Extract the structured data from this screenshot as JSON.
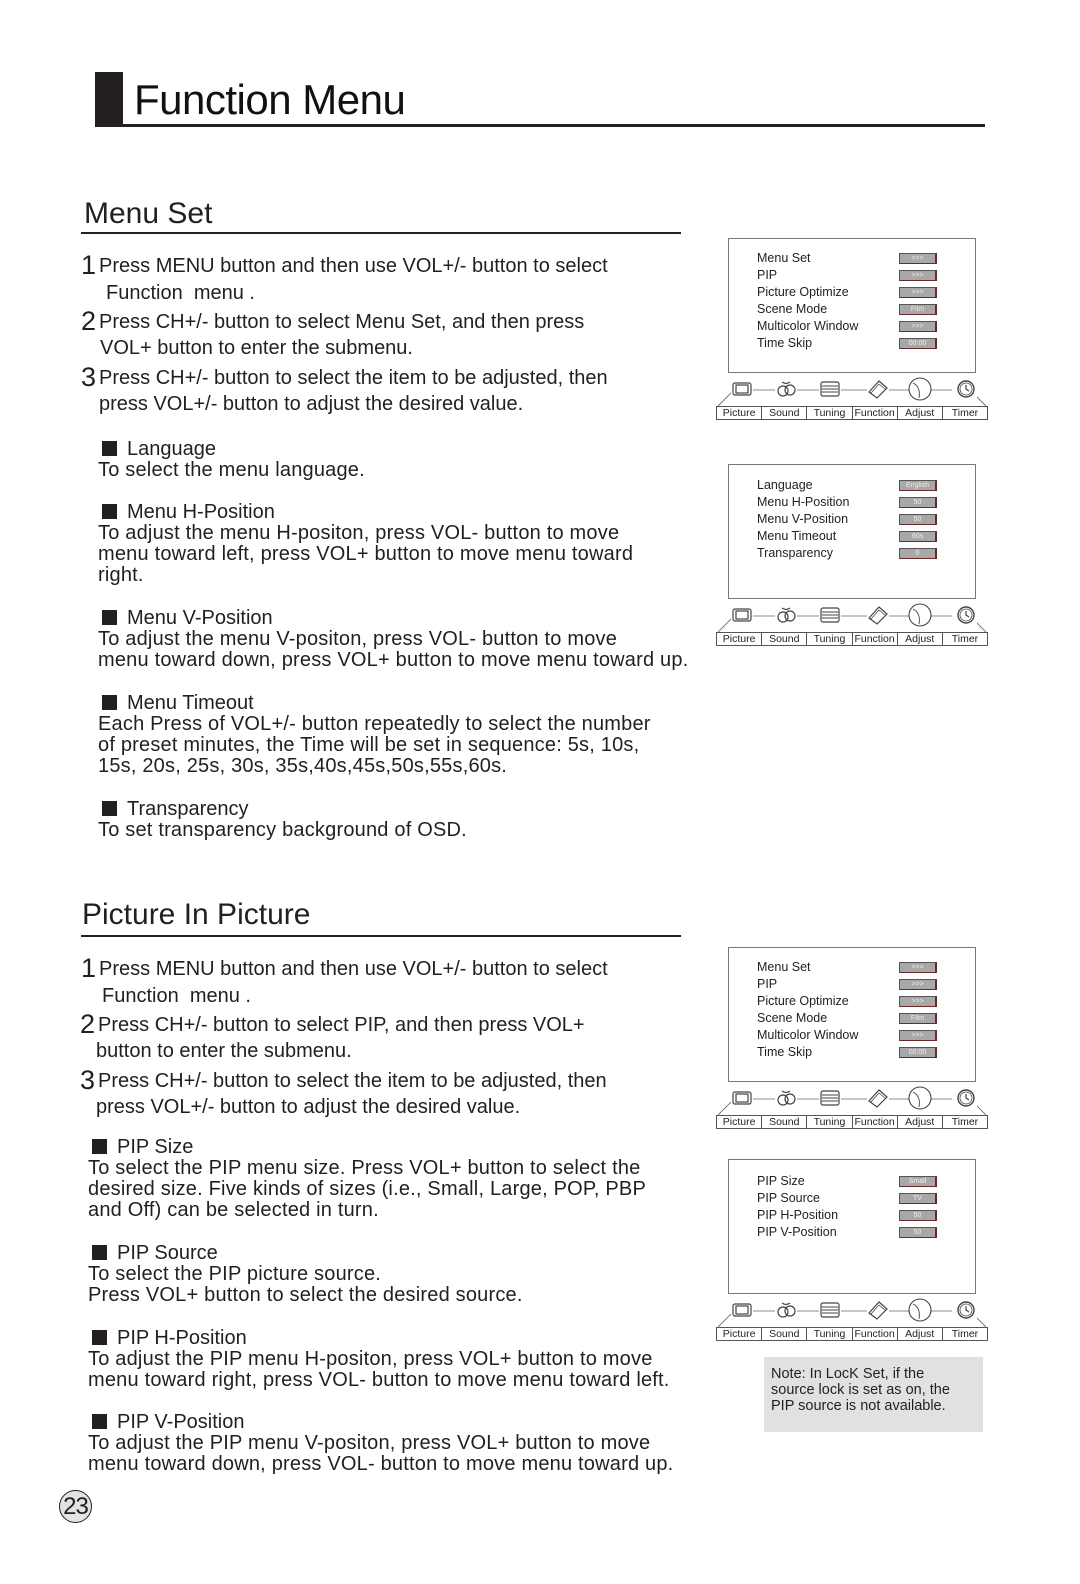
{
  "page": {
    "title": "Function Menu",
    "page_number": "23"
  },
  "menu_set": {
    "heading": "Menu Set",
    "steps": [
      {
        "num": "1",
        "line1": "Press MENU button and then use VOL+/- button to select",
        "line2": "Function  menu ."
      },
      {
        "num": "2",
        "line1": "Press CH+/- button to select Menu Set, and then press",
        "line2": "VOL+ button to enter the submenu."
      },
      {
        "num": "3",
        "line1": "Press CH+/- button to select  the item to be adjusted, then",
        "line2": "press VOL+/- button to adjust the desired value."
      }
    ],
    "features": [
      {
        "title": "Language",
        "body": "To select the menu language."
      },
      {
        "title": "Menu H-Position",
        "body": "To adjust the menu H-positon, press VOL- button to move\nmenu toward left, press VOL+ button to move menu toward\nright."
      },
      {
        "title": "Menu V-Position",
        "body": "To adjust the menu V-positon, press VOL- button to move\nmenu toward down, press VOL+ button to move menu toward up."
      },
      {
        "title": "Menu Timeout",
        "body": "Each Press of VOL+/- button repeatedly to select the number\nof preset minutes, the Time will be set in sequence: 5s,  10s,\n15s,  20s,  25s,  30s, 35s,40s,45s,50s,55s,60s."
      },
      {
        "title": "Transparency",
        "body": "To set transparency background of OSD."
      }
    ]
  },
  "pip": {
    "heading": "Picture In Picture",
    "steps": [
      {
        "num": "1",
        "line1": "Press MENU button and then use VOL+/- button to select",
        "line2": "Function  menu ."
      },
      {
        "num": "2",
        "line1": "Press CH+/- button to select PIP, and then press VOL+",
        "line2": "button to enter the submenu."
      },
      {
        "num": "3",
        "line1": "Press CH+/- button to select  the item to be adjusted, then",
        "line2": "press VOL+/- button to adjust the desired value."
      }
    ],
    "features": [
      {
        "title": "PIP Size",
        "body": "To select the PIP menu size. Press VOL+ button to select the\ndesired size. Five kinds of sizes (i.e., Small, Large, POP, PBP\nand Off) can be selected in turn."
      },
      {
        "title": "PIP Source",
        "body": "To select the PIP picture source.\nPress VOL+ button to select the desired source."
      },
      {
        "title": "PIP H-Position",
        "body": "To adjust the PIP menu H-positon, press VOL+ button to move\nmenu toward right, press VOL- button to move menu toward left."
      },
      {
        "title": "PIP V-Position",
        "body": "To adjust the PIP menu V-positon, press VOL+ button to move\nmenu toward down, press VOL- button to move menu toward up."
      }
    ],
    "note": "Note: In LocK Set, if the\nsource lock is set as on, the\nPIP source is not available."
  },
  "osd": {
    "tabs": [
      "Picture",
      "Sound",
      "Tuning",
      "Function",
      "Adjust",
      "Timer"
    ],
    "tab_icons": [
      "picture-icon",
      "sound-icon",
      "tuning-icon",
      "function-icon",
      "adjust-icon",
      "timer-icon"
    ],
    "function_menu": [
      {
        "label": "Menu Set",
        "value": ">>>"
      },
      {
        "label": "PIP",
        "value": ">>>"
      },
      {
        "label": "Picture Optimize",
        "value": ">>>"
      },
      {
        "label": "Scene Mode",
        "value": "Film"
      },
      {
        "label": "Multicolor Window",
        "value": ">>>"
      },
      {
        "label": "Time Skip",
        "value": "00:00"
      }
    ],
    "menu_set_sub": [
      {
        "label": "Language",
        "value": "English"
      },
      {
        "label": "Menu H-Position",
        "value": "50"
      },
      {
        "label": "Menu V-Position",
        "value": "50"
      },
      {
        "label": "Menu Timeout",
        "value": "60s"
      },
      {
        "label": "Transparency",
        "value": "0"
      }
    ],
    "pip_sub": [
      {
        "label": "PIP Size",
        "value": "Small"
      },
      {
        "label": "PIP Source",
        "value": "TV"
      },
      {
        "label": "PIP H-Position",
        "value": "50"
      },
      {
        "label": "PIP V-Position",
        "value": "50"
      }
    ]
  }
}
